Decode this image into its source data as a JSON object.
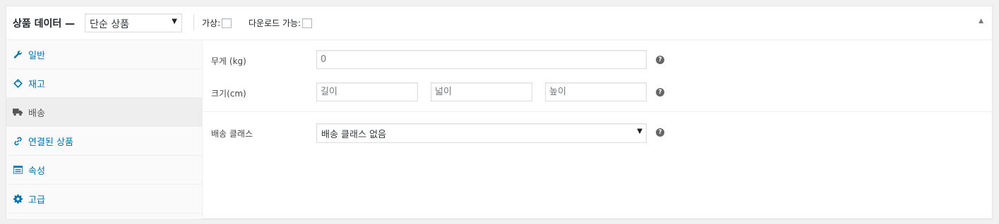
{
  "header": {
    "title": "상품 데이터 —",
    "product_type": "단순 상품",
    "virtual_label": "가상:",
    "downloadable_label": "다운로드 가능:",
    "collapse_icon": "triangle-up-icon"
  },
  "sidebar": {
    "items": [
      {
        "label": "일반",
        "icon": "wrench-icon",
        "active": false
      },
      {
        "label": "재고",
        "icon": "tag-icon",
        "active": false
      },
      {
        "label": "배송",
        "icon": "truck-icon",
        "active": true
      },
      {
        "label": "연결된 상품",
        "icon": "link-icon",
        "active": false
      },
      {
        "label": "속성",
        "icon": "list-table-icon",
        "active": false
      },
      {
        "label": "고급",
        "icon": "gear-icon",
        "active": false
      }
    ]
  },
  "shipping": {
    "weight_label": "무게 (kg)",
    "weight_placeholder": "0",
    "dimensions_label": "크기(cm)",
    "length_placeholder": "길이",
    "width_placeholder": "넓이",
    "height_placeholder": "높이",
    "class_label": "배송 클래스",
    "class_value": "배송 클래스 없음",
    "help_glyph": "?"
  }
}
